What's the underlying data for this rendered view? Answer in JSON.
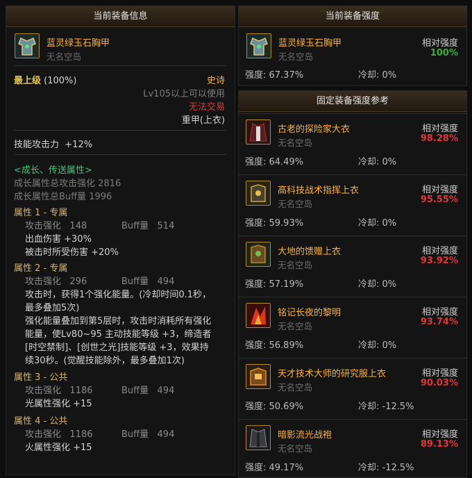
{
  "left_panel": {
    "title": "当前装备信息",
    "item": {
      "name": "蓝灵绿玉石胸甲",
      "source": "无名空岛",
      "grade": "最上级",
      "grade_pct": "(100%)",
      "rarity": "史诗",
      "level_req": "Lv105以上可以使用",
      "trade": "无法交易",
      "type": "重甲(上衣)",
      "skill_atk_label": "技能攻击力",
      "skill_atk_val": "+12%"
    },
    "growth": {
      "title": "<成长、传送属性>",
      "total_atk": "成长属性总攻击强化 2816",
      "total_buff": "成长属性总Buff量 1996"
    },
    "attrs": [
      {
        "title": "属性 1 - 专属",
        "atk_label": "攻击强化",
        "atk_val": "148",
        "buff_label": "Buff量",
        "buff_val": "514",
        "lines": [
          "出血伤害 +30%",
          "被击时所受伤害 +20%"
        ]
      },
      {
        "title": "属性 2 - 专属",
        "atk_label": "攻击强化",
        "atk_val": "296",
        "buff_label": "Buff量",
        "buff_val": "494",
        "lines": [
          "攻击时，获得1个强化能量。(冷却时间0.1秒，",
          "最多叠加5次)",
          "强化能量叠加到第5层时，攻击时消耗所有强化",
          "能量，使Lv80~95 主动技能等级 +3，缔造者",
          "[时空禁制]、[创世之光]技能等级 +3，效果持",
          "续30秒。(觉醒技能除外，最多叠加1次)"
        ]
      },
      {
        "title": "属性 3 - 公共",
        "atk_label": "攻击强化",
        "atk_val": "1186",
        "buff_label": "Buff量",
        "buff_val": "494",
        "lines": [
          "光属性强化 +15"
        ]
      },
      {
        "title": "属性 4 - 公共",
        "atk_label": "攻击强化",
        "atk_val": "1186",
        "buff_label": "Buff量",
        "buff_val": "494",
        "lines": [
          "火属性强化 +15"
        ]
      }
    ]
  },
  "current_strength": {
    "title": "当前装备强度",
    "name": "蓝灵绿玉石胸甲",
    "source": "无名空岛",
    "rel_label": "相对强度",
    "rel_val": "100%",
    "strength": "强度: 67.37%",
    "cooldown": "冷却: 0%"
  },
  "reference": {
    "title": "固定装备强度参考",
    "rel_label": "相对强度",
    "items": [
      {
        "name": "古老的探险家大衣",
        "source": "无名空岛",
        "rel_val": "98.28%",
        "strength": "强度: 64.49%",
        "cooldown": "冷却: 0%",
        "icon": "coat-icon"
      },
      {
        "name": "高科技战术指挥上衣",
        "source": "无名空岛",
        "rel_val": "95.55%",
        "strength": "强度: 59.93%",
        "cooldown": "冷却: 0%",
        "icon": "armor-icon"
      },
      {
        "name": "大地的馈赠上衣",
        "source": "无名空岛",
        "rel_val": "93.92%",
        "strength": "强度: 57.19%",
        "cooldown": "冷却: 0%",
        "icon": "earth-armor-icon"
      },
      {
        "name": "铭记长夜的黎明",
        "source": "无名空岛",
        "rel_val": "93.74%",
        "strength": "强度: 56.89%",
        "cooldown": "冷却: 0%",
        "icon": "flame-icon"
      },
      {
        "name": "天才技术大师的研究服上衣",
        "source": "无名空岛",
        "rel_val": "90.03%",
        "strength": "强度: 50.69%",
        "cooldown": "冷却: -12.5%",
        "icon": "tech-armor-icon"
      },
      {
        "name": "暗影流光战袍",
        "source": "无名空岛",
        "rel_val": "89.13%",
        "strength": "强度: 49.17%",
        "cooldown": "冷却: -12.5%",
        "icon": "shadow-robe-icon"
      }
    ]
  },
  "colors": {
    "item_name": "#ffb13b",
    "rel_green": "#3fae3f",
    "rel_red": "#e0353a",
    "growth_green": "#4fc27a",
    "attr_gold": "#d7b46a"
  }
}
